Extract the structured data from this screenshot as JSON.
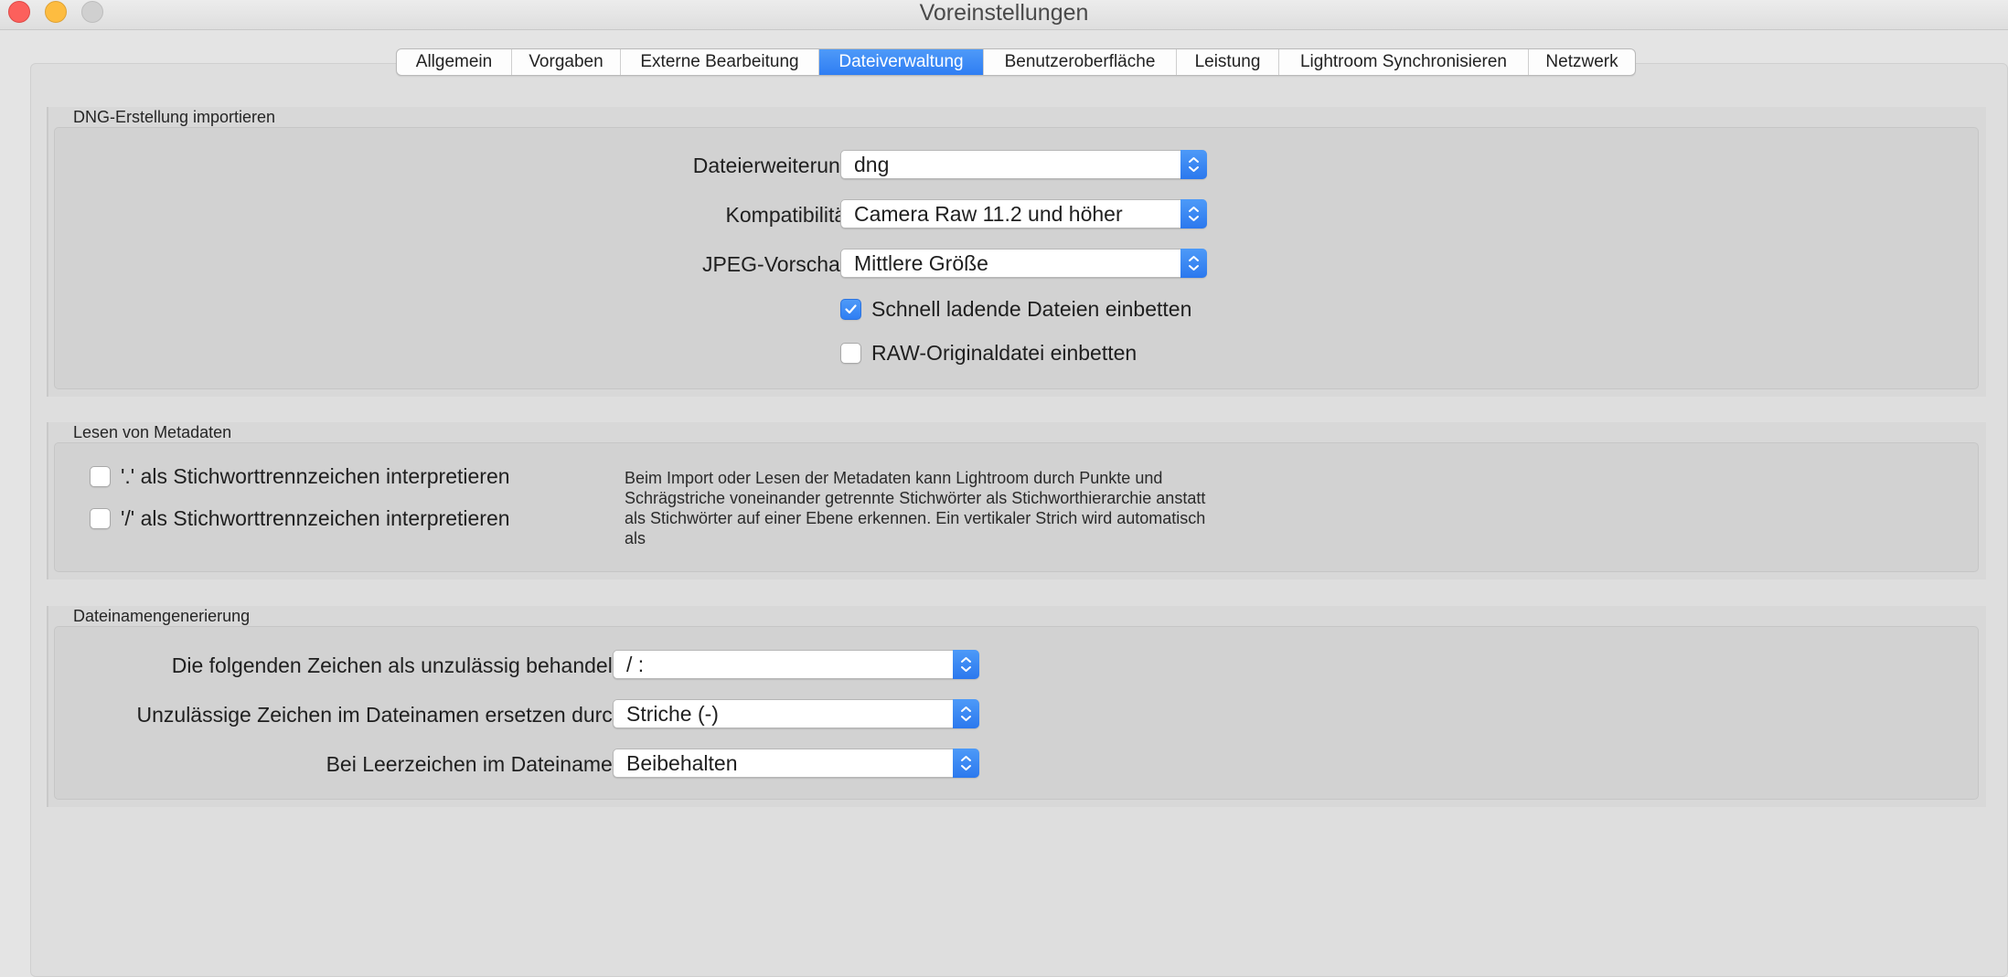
{
  "window": {
    "title": "Voreinstellungen",
    "accent_color": "#2f7ef3"
  },
  "tabs": [
    {
      "label": "Allgemein",
      "active": false
    },
    {
      "label": "Vorgaben",
      "active": false
    },
    {
      "label": "Externe Bearbeitung",
      "active": false
    },
    {
      "label": "Dateiverwaltung",
      "active": true
    },
    {
      "label": "Benutzeroberfläche",
      "active": false
    },
    {
      "label": "Leistung",
      "active": false
    },
    {
      "label": "Lightroom Synchronisieren",
      "active": false
    },
    {
      "label": "Netzwerk",
      "active": false
    }
  ],
  "dng": {
    "title": "DNG-Erstellung importieren",
    "extension": {
      "label": "Dateierweiterung:",
      "value": "dng"
    },
    "compatibility": {
      "label": "Kompatibilität:",
      "value": "Camera Raw 11.2 und höher"
    },
    "jpeg_preview": {
      "label": "JPEG-Vorschau:",
      "value": "Mittlere Größe"
    },
    "fast_load": {
      "label": "Schnell ladende Dateien einbetten",
      "checked": true
    },
    "embed_raw": {
      "label": "RAW-Originaldatei einbetten",
      "checked": false
    }
  },
  "metadata": {
    "title": "Lesen von Metadaten",
    "dot_separator": {
      "label": "'.' als Stichworttrennzeichen interpretieren",
      "checked": false
    },
    "slash_separator": {
      "label": "'/' als Stichworttrennzeichen interpretieren",
      "checked": false
    },
    "help_text": "Beim Import oder Lesen der Metadaten kann Lightroom durch Punkte und Schrägstriche voneinander getrennte Stichwörter als Stichworthierarchie anstatt als Stichwörter auf einer Ebene erkennen. Ein vertikaler Strich wird automatisch als"
  },
  "filename": {
    "title": "Dateinamengenerierung",
    "illegal_chars": {
      "label": "Die folgenden Zeichen als unzulässig behandeln:",
      "value": "/ :"
    },
    "replace_with": {
      "label": "Unzulässige Zeichen im Dateinamen ersetzen durch:",
      "value": "Striche (-)"
    },
    "spaces": {
      "label": "Bei Leerzeichen im Dateinamen:",
      "value": "Beibehalten"
    }
  }
}
